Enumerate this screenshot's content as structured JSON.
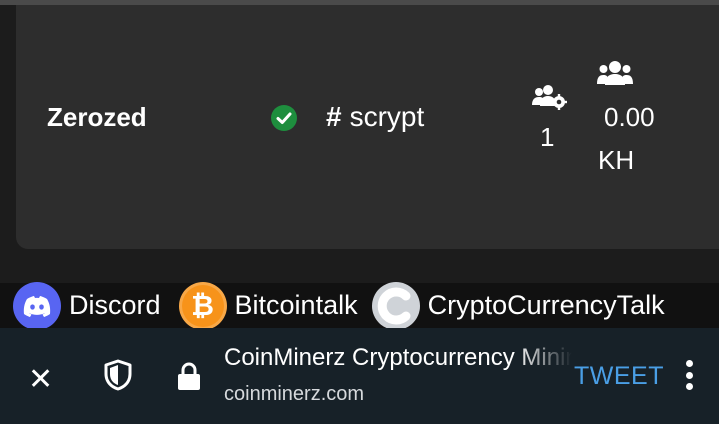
{
  "pool_row": {
    "name": "Zerozed",
    "status": "online",
    "algorithm": "scrypt",
    "miners_count": "1",
    "hashrate_value": "0.00",
    "hashrate_unit": "KH"
  },
  "links": [
    {
      "label": "Discord",
      "icon": "discord-icon"
    },
    {
      "label": "Bitcointalk",
      "icon": "bitcoin-icon"
    },
    {
      "label": "CryptoCurrencyTalk",
      "icon": "cct-icon"
    }
  ],
  "browser_bar": {
    "title": "CoinMinerz Cryptocurrency Mining Pool",
    "url": "coinminerz.com",
    "tweet_label": "TWEET"
  },
  "colors": {
    "status_green": "#1e8e3e",
    "tweet_blue": "#4a9fe6",
    "bar_bg": "#172128",
    "card_bg": "#2d2d2d"
  }
}
